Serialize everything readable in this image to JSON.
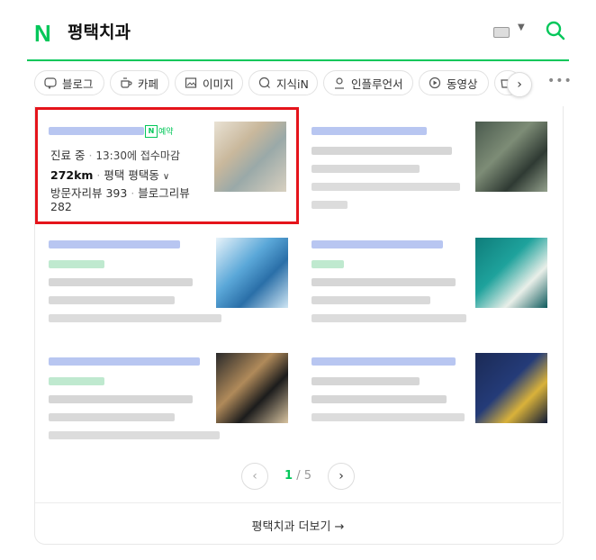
{
  "header": {
    "logo": "N",
    "query": "평택치과"
  },
  "tabs": [
    {
      "label": "블로그",
      "icon": "blog-icon"
    },
    {
      "label": "카페",
      "icon": "cafe-icon"
    },
    {
      "label": "이미지",
      "icon": "image-icon"
    },
    {
      "label": "지식iN",
      "icon": "kin-icon"
    },
    {
      "label": "인플루언서",
      "icon": "influencer-icon"
    },
    {
      "label": "동영상",
      "icon": "video-icon"
    }
  ],
  "result1": {
    "badge": "N",
    "reserve": "예약",
    "status": "진료 중",
    "status_detail": "13:30에 접수마감",
    "distance": "272km",
    "address": "평택 평택동",
    "review_visitor": "방문자리뷰 393",
    "review_blog_label": "블로그리뷰",
    "review_blog_count": "282"
  },
  "pager": {
    "current": "1",
    "total": "/ 5"
  },
  "more_link": "평택치과 더보기 →"
}
